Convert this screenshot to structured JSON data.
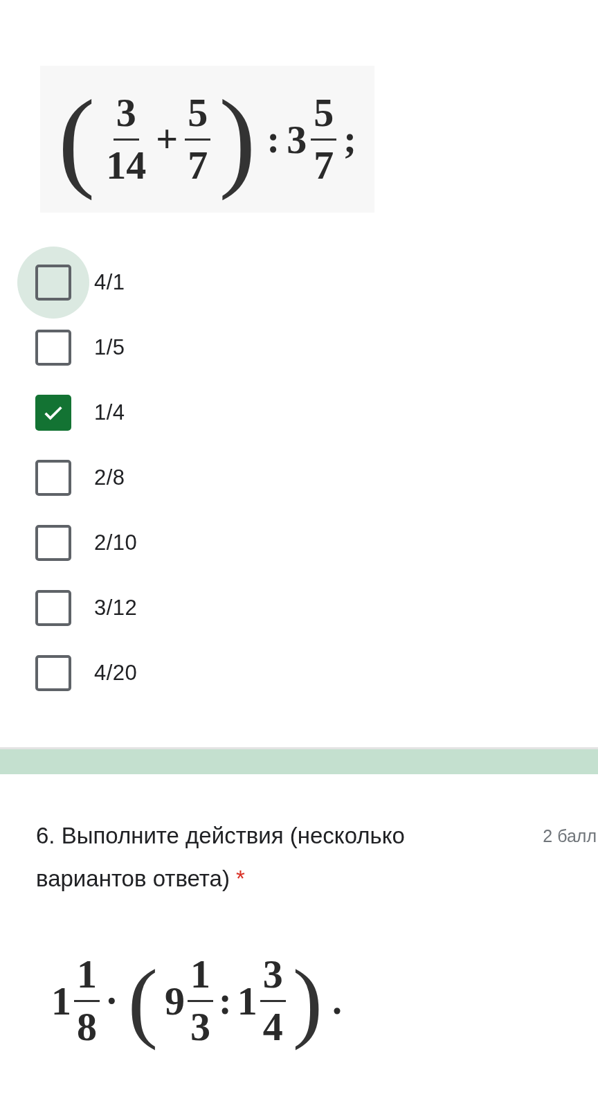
{
  "question_5": {
    "formula": [
      {
        "kind": "paren",
        "text": "("
      },
      {
        "kind": "frac",
        "num": "3",
        "den": "14"
      },
      {
        "kind": "op",
        "text": "+"
      },
      {
        "kind": "frac",
        "num": "5",
        "den": "7"
      },
      {
        "kind": "paren",
        "text": ")"
      },
      {
        "kind": "op",
        "text": ":"
      },
      {
        "kind": "int",
        "text": "3"
      },
      {
        "kind": "frac",
        "num": "5",
        "den": "7"
      },
      {
        "kind": "op",
        "text": ";"
      }
    ],
    "options": [
      {
        "label": "4/1",
        "checked": false,
        "focused": true
      },
      {
        "label": "1/5",
        "checked": false,
        "focused": false
      },
      {
        "label": "1/4",
        "checked": true,
        "focused": false
      },
      {
        "label": "2/8",
        "checked": false,
        "focused": false
      },
      {
        "label": "2/10",
        "checked": false,
        "focused": false
      },
      {
        "label": "3/12",
        "checked": false,
        "focused": false
      },
      {
        "label": "4/20",
        "checked": false,
        "focused": false
      }
    ]
  },
  "question_6": {
    "title": "6. Выполните действия (несколько вариантов ответа)",
    "required": true,
    "required_mark": "*",
    "points": "2 балл",
    "formula": [
      {
        "kind": "int",
        "text": "1"
      },
      {
        "kind": "frac",
        "num": "1",
        "den": "8"
      },
      {
        "kind": "op",
        "text": "·"
      },
      {
        "kind": "paren",
        "text": "("
      },
      {
        "kind": "int",
        "text": "9"
      },
      {
        "kind": "frac",
        "num": "1",
        "den": "3"
      },
      {
        "kind": "op",
        "text": ":"
      },
      {
        "kind": "int",
        "text": "1"
      },
      {
        "kind": "frac",
        "num": "3",
        "den": "4"
      },
      {
        "kind": "paren",
        "text": ")"
      },
      {
        "kind": "op",
        "text": "."
      }
    ]
  }
}
